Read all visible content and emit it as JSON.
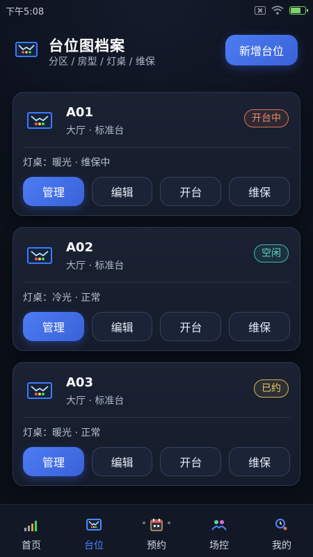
{
  "status_bar": {
    "time": "下午5:08"
  },
  "header": {
    "title": "台位图档案",
    "subtitle": "分区 / 房型 / 灯桌 / 维保",
    "add_label": "新增台位"
  },
  "cards": [
    {
      "name": "A01",
      "sub": "大厅 · 标准台",
      "status": "开台中",
      "info": "灯桌：暖光 · 维保中",
      "actions": [
        "管理",
        "编辑",
        "开台",
        "维保"
      ]
    },
    {
      "name": "A02",
      "sub": "大厅 · 标准台",
      "status": "空闲",
      "info": "灯桌：冷光 · 正常",
      "actions": [
        "管理",
        "编辑",
        "开台",
        "维保"
      ]
    },
    {
      "name": "A03",
      "sub": "大厅 · 标准台",
      "status": "已约",
      "info": "灯桌：暖光 · 正常",
      "actions": [
        "管理",
        "编辑",
        "开台",
        "维保"
      ]
    }
  ],
  "nav": [
    {
      "label": "首页",
      "icon": "bar-chart-icon"
    },
    {
      "label": "台位",
      "icon": "table-icon",
      "active": true
    },
    {
      "label": "预约",
      "icon": "calendar-icon"
    },
    {
      "label": "场控",
      "icon": "people-icon"
    },
    {
      "label": "我的",
      "icon": "user-clock-icon"
    }
  ],
  "colors": {
    "accent": "#4c7cf3",
    "busy": "#e0714f",
    "idle": "#3fbfae",
    "booked": "#d9b451"
  }
}
